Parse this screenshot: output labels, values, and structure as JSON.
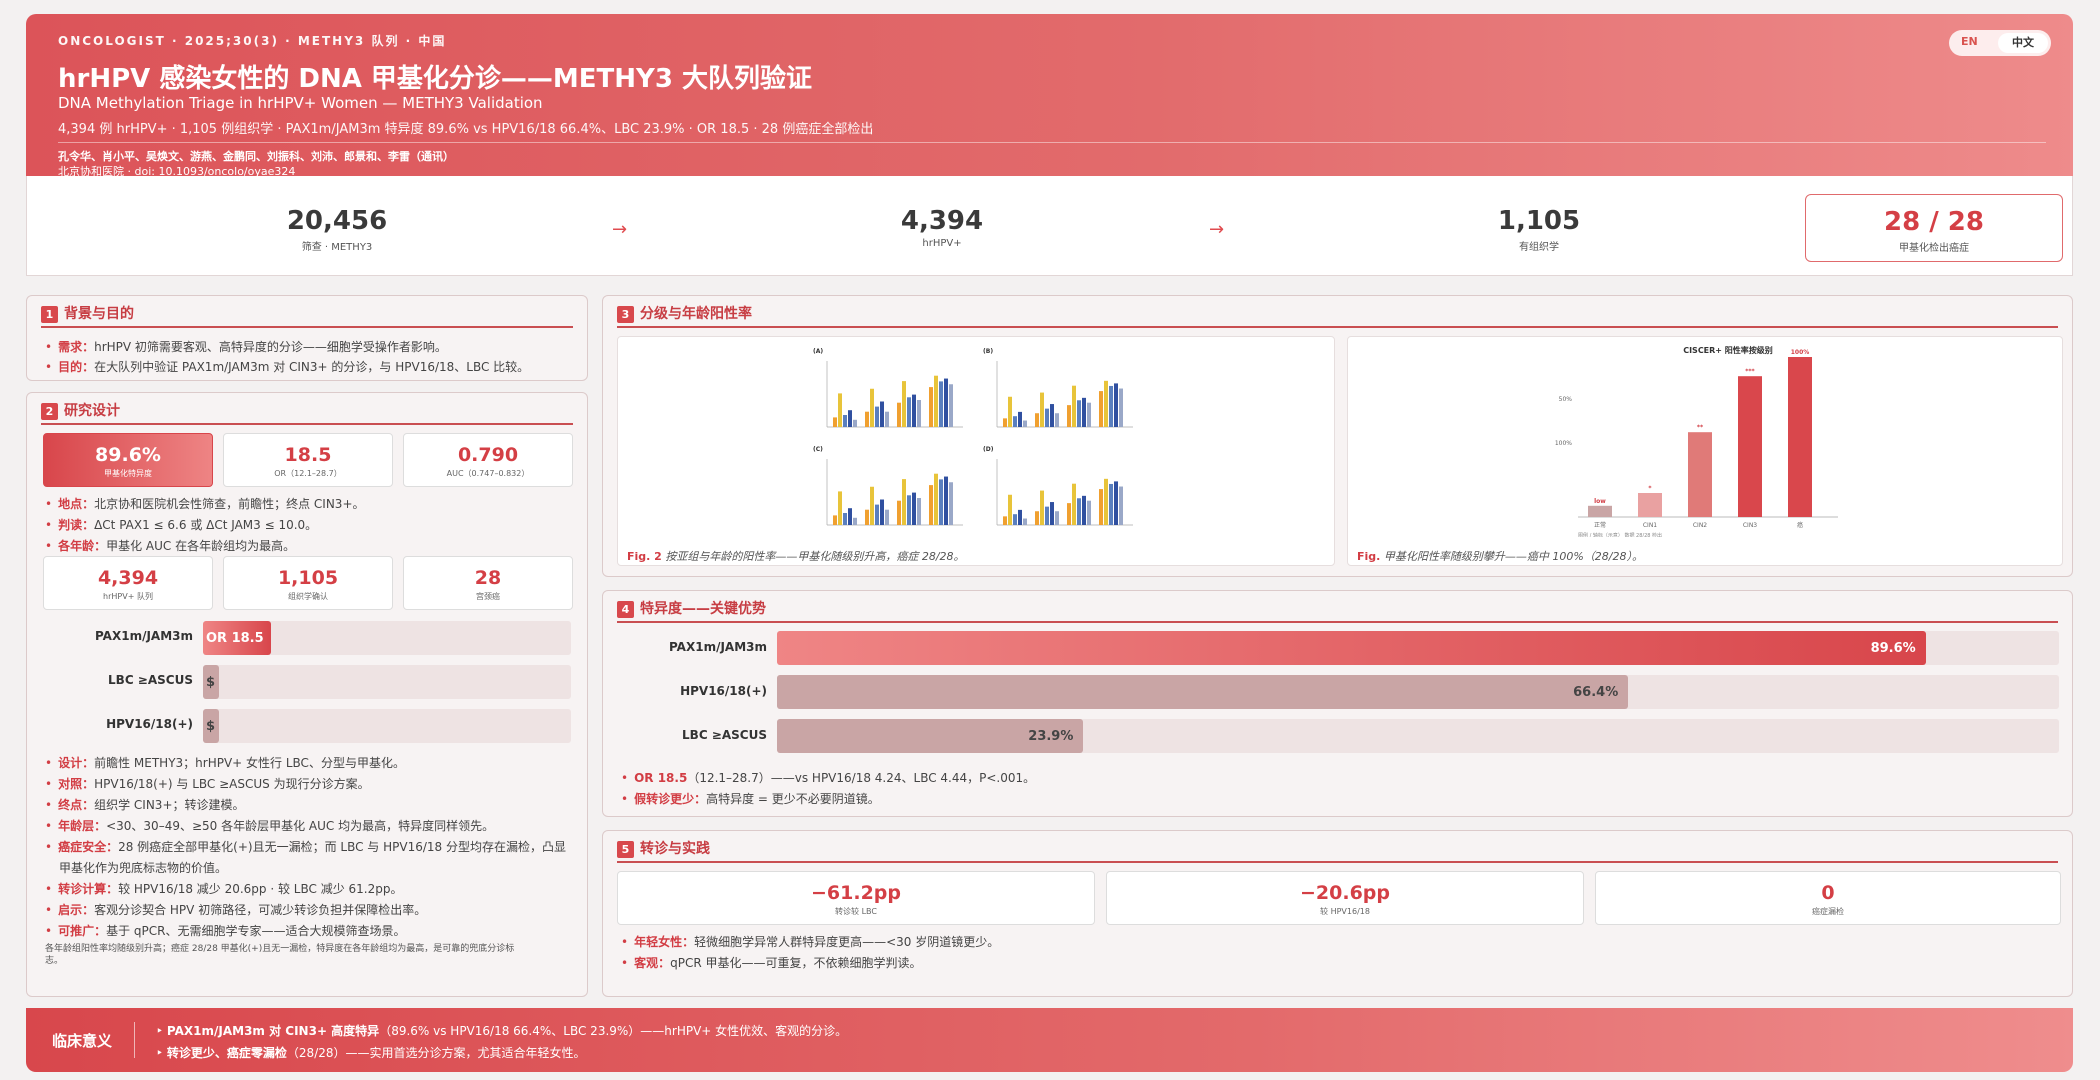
{
  "header": {
    "meta": "ONCOLOGIST · 2025;30(3) · METHY3 队列 · 中国",
    "title": "hrHPV 感染女性的 DNA 甲基化分诊——METHY3 大队列验证",
    "subtitle": "DNA Methylation Triage in hrHPV+ Women — METHY3 Validation",
    "stats": "4,394 例 hrHPV+ · 1,105 例组织学 · PAX1m/JAM3m 特异度 89.6% vs HPV16/18 66.4%、LBC 23.9% · OR 18.5 · 28 例癌症全部检出",
    "authors": "孔令华、肖小平、吴焕文、游燕、金鹏同、刘振科、刘沛、郎景和、李雷（通讯）",
    "affiliation": "北京协和医院 · doi: ",
    "doi": "10.1093/oncolo/oyae324",
    "lang_en": "EN",
    "lang_zh": "中文"
  },
  "kpi": [
    {
      "value": "20,456",
      "label": "筛查 · METHY3"
    },
    {
      "value": "4,394",
      "label": "hrHPV+"
    },
    {
      "value": "1,105",
      "label": "有组织学"
    },
    {
      "value": "28 / 28",
      "label": "甲基化检出癌症"
    }
  ],
  "arrow": "→",
  "sec1": {
    "num": "1",
    "title": "背景与目的",
    "items": [
      {
        "k": "需求：",
        "v": "hrHPV 初筛需要客观、高特异度的分诊——细胞学受操作者影响。"
      },
      {
        "k": "目的：",
        "v": "在大队列中验证 PAX1m/JAM3m 对 CIN3+ 的分诊，与 HPV16/18、LBC 比较。"
      }
    ]
  },
  "sec2": {
    "num": "2",
    "title": "研究设计",
    "boxes1": [
      {
        "v": "89.6%",
        "l": "甲基化特异度"
      },
      {
        "v": "18.5",
        "l": "OR（12.1–28.7）"
      },
      {
        "v": "0.790",
        "l": "AUC（0.747–0.832）"
      }
    ],
    "items1": [
      {
        "k": "地点：",
        "v": "北京协和医院机会性筛查，前瞻性；终点 CIN3+。"
      },
      {
        "k": "判读：",
        "v": "ΔCt PAX1 ≤ 6.6 或 ΔCt JAM3 ≤ 10.0。"
      },
      {
        "k": "各年龄：",
        "v": "甲基化 AUC 在各年龄组均为最高。"
      }
    ],
    "boxes2": [
      {
        "v": "4,394",
        "l": "hrHPV+ 队列"
      },
      {
        "v": "1,105",
        "l": "组织学确认"
      },
      {
        "v": "28",
        "l": "宫颈癌"
      }
    ],
    "or_bars": [
      {
        "label": "PAX1m/JAM3m",
        "value": 18.5,
        "text": "OR 18.5"
      },
      {
        "label": "LBC ≥ASCUS",
        "value": 4.44,
        "text": "$"
      },
      {
        "label": "HPV16/18(+)",
        "value": 4.24,
        "text": "$"
      }
    ],
    "or_max": 100,
    "items2": [
      {
        "k": "设计：",
        "v": "前瞻性 METHY3；hrHPV+ 女性行 LBC、分型与甲基化。"
      },
      {
        "k": "对照：",
        "v": "HPV16/18(+) 与 LBC ≥ASCUS 为现行分诊方案。"
      },
      {
        "k": "终点：",
        "v": "组织学 CIN3+；转诊建模。"
      },
      {
        "k": "年龄层：",
        "v": "<30、30–49、≥50 各年龄层甲基化 AUC 均为最高，特异度同样领先。"
      },
      {
        "k": "癌症安全：",
        "v": "28 例癌症全部甲基化(+)且无一漏检；而 LBC 与 HPV16/18 分型均存在漏检，凸显"
      },
      {
        "k": "",
        "v": "甲基化作为兜底标志物的价值。"
      },
      {
        "k": "转诊计算：",
        "v": "较 HPV16/18 减少 20.6pp · 较 LBC 减少 61.2pp。"
      },
      {
        "k": "启示：",
        "v": "客观分诊契合 HPV 初筛路径，可减少转诊负担并保障检出率。"
      },
      {
        "k": "可推广：",
        "v": "基于 qPCR、无需细胞学专家——适合大规模筛查场景。"
      }
    ],
    "note1": "各年龄组阳性率均随级别升高；癌症 28/28 甲基化(+)且无一漏检，特异度在各年龄组均为最高，是可靠的兜底分诊标",
    "note2": "志。"
  },
  "sec3": {
    "num": "3",
    "title": "分级与年龄阳性率",
    "cap1_b": "Fig. 2",
    "cap1": " 按亚组与年龄的阳性率——甲基化随级别升高，癌症 28/28。",
    "cap2_b": "Fig.",
    "cap2": " 甲基化阳性率随级别攀升——癌中 100%（28/28）。",
    "panels": [
      "(A)",
      "(B)",
      "(C)",
      "(D)"
    ],
    "chart": {
      "title": "CISCER+ 阳性率按级别",
      "categories": [
        "正常",
        "CIN1",
        "CIN2",
        "CIN3",
        "癌"
      ],
      "values": [
        7,
        15,
        53,
        88,
        100
      ],
      "bar_labels": [
        "low",
        "*",
        "**",
        "***",
        "100%"
      ],
      "yticks": [
        "50%",
        "100%"
      ],
      "legend": "图例 / 轴标（示意） 数据 28/28 检出"
    }
  },
  "sec4": {
    "num": "4",
    "title": "特异度——关键优势",
    "bars": [
      {
        "label": "PAX1m/JAM3m",
        "value": 89.6,
        "text": "89.6%"
      },
      {
        "label": "HPV16/18(+)",
        "value": 66.4,
        "text": "66.4%"
      },
      {
        "label": "LBC ≥ASCUS",
        "value": 23.9,
        "text": "23.9%"
      }
    ],
    "items": [
      {
        "k": "OR 18.5",
        "v": "（12.1–28.7）——vs HPV16/18 4.24、LBC 4.44，P<.001。"
      },
      {
        "k": "假转诊更少：",
        "v": "高特异度 = 更少不必要阴道镜。"
      }
    ]
  },
  "sec5": {
    "num": "5",
    "title": "转诊与实践",
    "boxes": [
      {
        "v": "−61.2pp",
        "l": "转诊较 LBC"
      },
      {
        "v": "−20.6pp",
        "l": "较 HPV16/18"
      },
      {
        "v": "0",
        "l": "癌症漏检"
      }
    ],
    "items": [
      {
        "k": "年轻女性：",
        "v": "轻微细胞学异常人群特异度更高——<30 岁阴道镜更少。"
      },
      {
        "k": "客观：",
        "v": "qPCR 甲基化——可重复，不依赖细胞学判读。"
      }
    ]
  },
  "footer": {
    "label": "临床意义",
    "line1_b": "PAX1m/JAM3m 对 CIN3+ 高度特异",
    "line1": "（89.6% vs HPV16/18 66.4%、LBC 23.9%）——hrHPV+ 女性优效、客观的分诊。",
    "line2_b": "转诊更少、癌症零漏检",
    "line2": "（28/28）——实用首选分诊方案，尤其适合年轻女性。",
    "marker": "‣"
  },
  "colors": {
    "accent": "#d8484c",
    "accent_light": "#ee8484",
    "grey_bar": "#c9a5a5"
  }
}
